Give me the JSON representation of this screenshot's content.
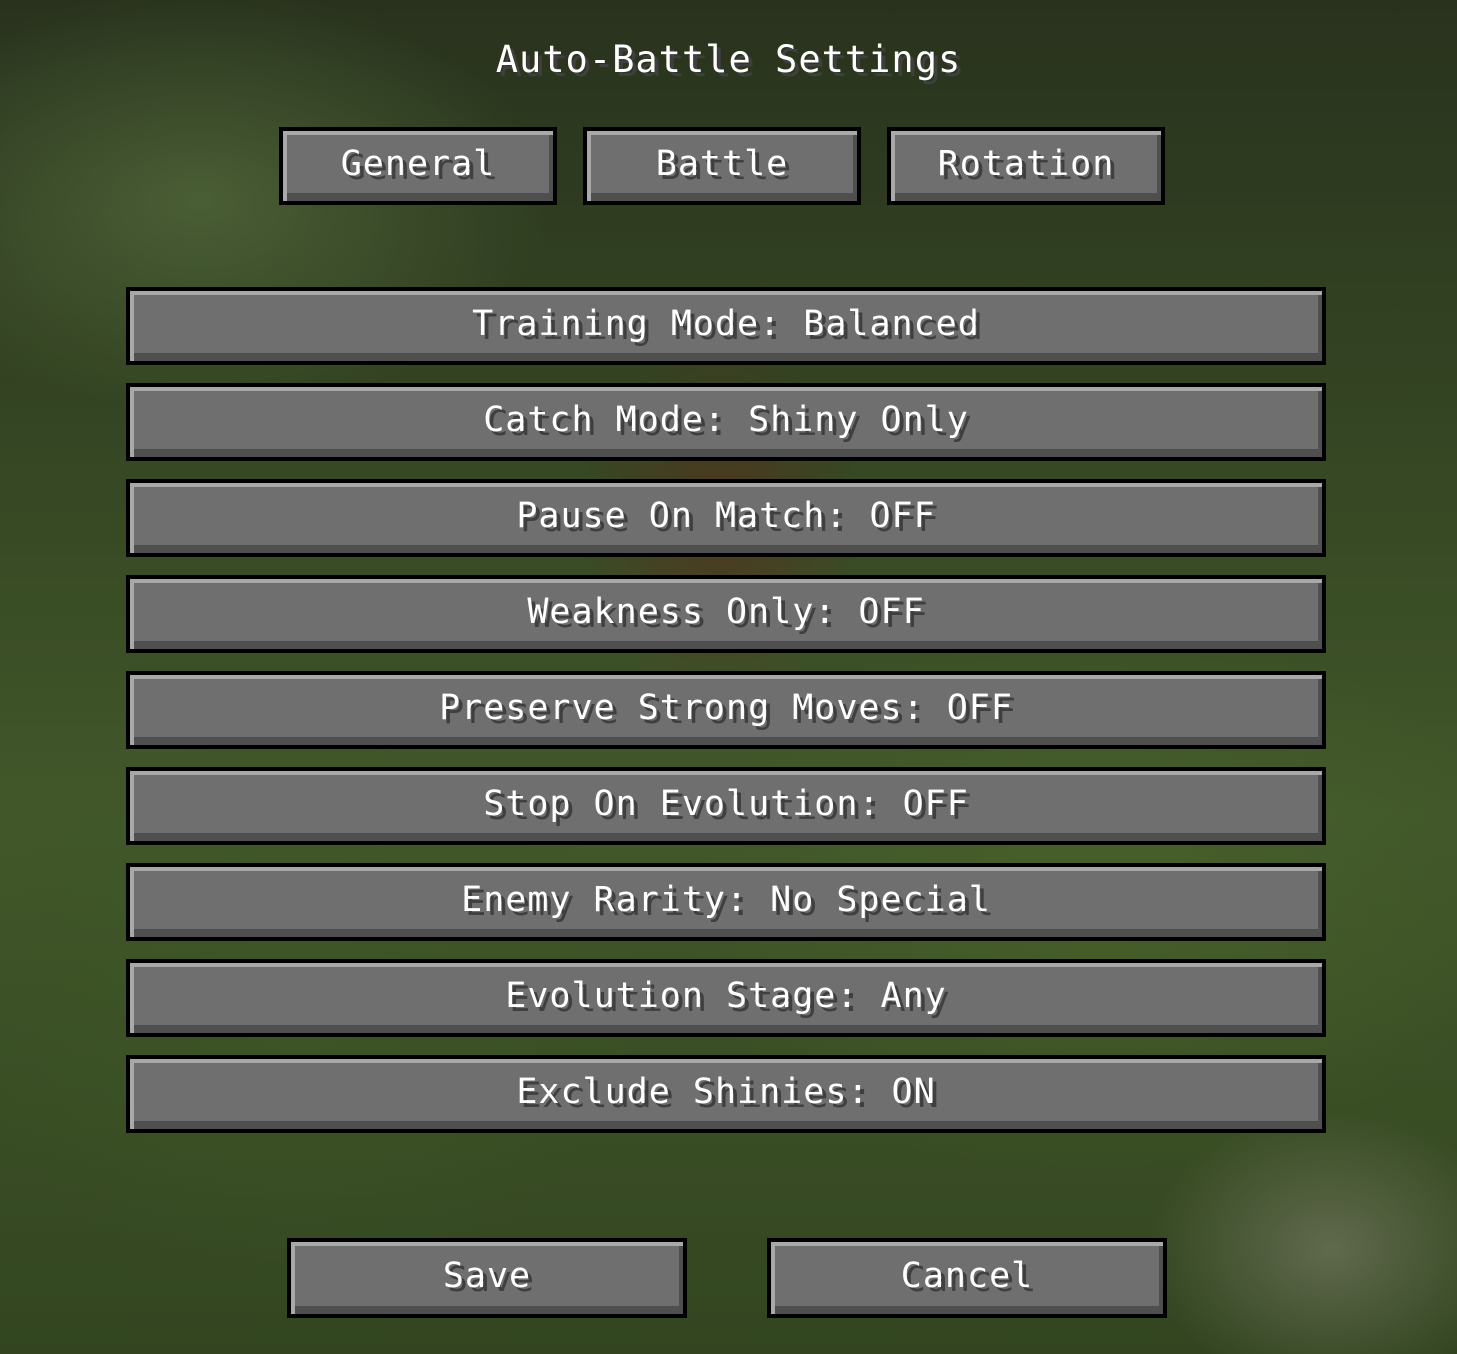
{
  "screen": {
    "title": "Auto-Battle Settings"
  },
  "tabs": [
    {
      "label": "General"
    },
    {
      "label": "Battle"
    },
    {
      "label": "Rotation"
    }
  ],
  "options": [
    {
      "label": "Training Mode: Balanced"
    },
    {
      "label": "Catch Mode: Shiny Only"
    },
    {
      "label": "Pause On Match: OFF"
    },
    {
      "label": "Weakness Only: OFF"
    },
    {
      "label": "Preserve Strong Moves: OFF"
    },
    {
      "label": "Stop On Evolution: OFF"
    },
    {
      "label": "Enemy Rarity: No Special"
    },
    {
      "label": "Evolution Stage: Any"
    },
    {
      "label": "Exclude Shinies: ON"
    }
  ],
  "footer": {
    "save_label": "Save",
    "cancel_label": "Cancel"
  },
  "colors": {
    "button_face": "#6f6f6f",
    "button_border": "#000000",
    "text": "#ffffff",
    "text_shadow": "#3f3f3f"
  }
}
